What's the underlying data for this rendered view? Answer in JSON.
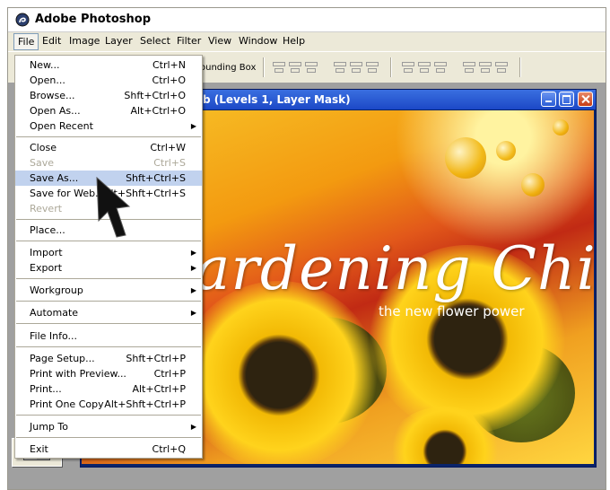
{
  "app": {
    "title": "Adobe Photoshop"
  },
  "menubar": [
    "File",
    "Edit",
    "Image",
    "Layer",
    "Select",
    "Filter",
    "View",
    "Window",
    "Help"
  ],
  "options_bar": {
    "bounding_box_label": "ounding Box"
  },
  "document": {
    "title": "b (Levels 1, Layer Mask)"
  },
  "artwork": {
    "title": "ardening Chi",
    "subtitle": "the new flower power"
  },
  "file_menu": {
    "items": [
      {
        "label": "New...",
        "shortcut": "Ctrl+N"
      },
      {
        "label": "Open...",
        "shortcut": "Ctrl+O"
      },
      {
        "label": "Browse...",
        "shortcut": "Shft+Ctrl+O"
      },
      {
        "label": "Open As...",
        "shortcut": "Alt+Ctrl+O"
      },
      {
        "label": "Open Recent",
        "shortcut": "",
        "submenu": true
      },
      {
        "label": "Close",
        "shortcut": "Ctrl+W"
      },
      {
        "label": "Save",
        "shortcut": "Ctrl+S",
        "disabled": true
      },
      {
        "label": "Save As...",
        "shortcut": "Shft+Ctrl+S",
        "selected": true
      },
      {
        "label": "Save for Web...",
        "shortcut": "Alt+Shft+Ctrl+S"
      },
      {
        "label": "Revert",
        "shortcut": "",
        "disabled": true
      },
      {
        "label": "Place...",
        "shortcut": ""
      },
      {
        "label": "Import",
        "shortcut": "",
        "submenu": true
      },
      {
        "label": "Export",
        "shortcut": "",
        "submenu": true
      },
      {
        "label": "Workgroup",
        "shortcut": "",
        "submenu": true
      },
      {
        "label": "Automate",
        "shortcut": "",
        "submenu": true
      },
      {
        "label": "File Info...",
        "shortcut": ""
      },
      {
        "label": "Page Setup...",
        "shortcut": "Shft+Ctrl+P"
      },
      {
        "label": "Print with Preview...",
        "shortcut": "Ctrl+P"
      },
      {
        "label": "Print...",
        "shortcut": "Alt+Ctrl+P"
      },
      {
        "label": "Print One Copy",
        "shortcut": "Alt+Shft+Ctrl+P"
      },
      {
        "label": "Jump To",
        "shortcut": "",
        "submenu": true
      },
      {
        "label": "Exit",
        "shortcut": "Ctrl+Q"
      }
    ]
  },
  "colors": {
    "selection": "#c1d2ee",
    "titlebar_blue": "#2a5bd7",
    "close_red": "#d14a20"
  },
  "icons": [
    "photoshop-app-icon",
    "submenu-arrow-icon",
    "minimize-icon",
    "maximize-icon",
    "close-icon",
    "pointer-arrow-icon",
    "quick-mask-icon"
  ]
}
